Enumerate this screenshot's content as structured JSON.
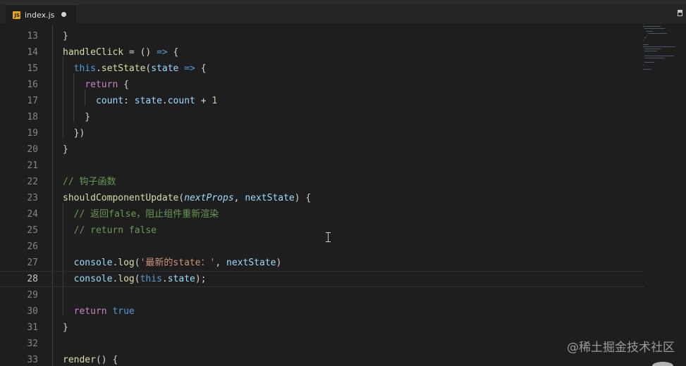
{
  "tab": {
    "filename": "index.js",
    "icon": "javascript-file-icon",
    "icon_letter": "JS",
    "dirty": true
  },
  "editor": {
    "current_line": 28,
    "lines": [
      {
        "n": "13",
        "tokens": [
          {
            "t": "}",
            "c": "p"
          }
        ]
      },
      {
        "n": "14",
        "tokens": [
          {
            "t": "handleClick",
            "c": "fn"
          },
          {
            "t": " = () ",
            "c": "p"
          },
          {
            "t": "=>",
            "c": "kw"
          },
          {
            "t": " {",
            "c": "p"
          }
        ]
      },
      {
        "n": "15",
        "tokens": [
          {
            "t": "  ",
            "c": "p"
          },
          {
            "t": "this",
            "c": "kw"
          },
          {
            "t": ".",
            "c": "p"
          },
          {
            "t": "setState",
            "c": "fn"
          },
          {
            "t": "(",
            "c": "p"
          },
          {
            "t": "state",
            "c": "var"
          },
          {
            "t": " ",
            "c": "p"
          },
          {
            "t": "=>",
            "c": "kw"
          },
          {
            "t": " {",
            "c": "p"
          }
        ]
      },
      {
        "n": "16",
        "tokens": [
          {
            "t": "    ",
            "c": "p"
          },
          {
            "t": "return",
            "c": "kw2"
          },
          {
            "t": " {",
            "c": "p"
          }
        ]
      },
      {
        "n": "17",
        "tokens": [
          {
            "t": "      ",
            "c": "p"
          },
          {
            "t": "count",
            "c": "var"
          },
          {
            "t": ": ",
            "c": "p"
          },
          {
            "t": "state",
            "c": "var"
          },
          {
            "t": ".",
            "c": "p"
          },
          {
            "t": "count",
            "c": "var"
          },
          {
            "t": " + ",
            "c": "p"
          },
          {
            "t": "1",
            "c": "num"
          }
        ]
      },
      {
        "n": "18",
        "tokens": [
          {
            "t": "    }",
            "c": "p"
          }
        ]
      },
      {
        "n": "19",
        "tokens": [
          {
            "t": "  })",
            "c": "p"
          }
        ]
      },
      {
        "n": "20",
        "tokens": [
          {
            "t": "}",
            "c": "p"
          }
        ]
      },
      {
        "n": "21",
        "tokens": []
      },
      {
        "n": "22",
        "tokens": [
          {
            "t": "// 钩子函数",
            "c": "cmt"
          }
        ]
      },
      {
        "n": "23",
        "tokens": [
          {
            "t": "shouldComponentUpdate",
            "c": "fn"
          },
          {
            "t": "(",
            "c": "p"
          },
          {
            "t": "nextProps",
            "c": "var ital"
          },
          {
            "t": ", ",
            "c": "p"
          },
          {
            "t": "nextState",
            "c": "var"
          },
          {
            "t": ") {",
            "c": "p"
          }
        ]
      },
      {
        "n": "24",
        "tokens": [
          {
            "t": "  // 返回false，阻止组件重新渲染",
            "c": "cmt"
          }
        ]
      },
      {
        "n": "25",
        "tokens": [
          {
            "t": "  // return false",
            "c": "cmt"
          }
        ]
      },
      {
        "n": "26",
        "tokens": []
      },
      {
        "n": "27",
        "tokens": [
          {
            "t": "  ",
            "c": "p"
          },
          {
            "t": "console",
            "c": "var"
          },
          {
            "t": ".",
            "c": "p"
          },
          {
            "t": "log",
            "c": "fn"
          },
          {
            "t": "(",
            "c": "p"
          },
          {
            "t": "'最新的state：'",
            "c": "str"
          },
          {
            "t": ", ",
            "c": "p"
          },
          {
            "t": "nextState",
            "c": "var"
          },
          {
            "t": ")",
            "c": "p"
          }
        ]
      },
      {
        "n": "28",
        "tokens": [
          {
            "t": "  ",
            "c": "p"
          },
          {
            "t": "console",
            "c": "var"
          },
          {
            "t": ".",
            "c": "p"
          },
          {
            "t": "log",
            "c": "fn"
          },
          {
            "t": "(",
            "c": "p"
          },
          {
            "t": "this",
            "c": "kw"
          },
          {
            "t": ".",
            "c": "p"
          },
          {
            "t": "state",
            "c": "var"
          },
          {
            "t": ");",
            "c": "p"
          }
        ]
      },
      {
        "n": "29",
        "tokens": []
      },
      {
        "n": "30",
        "tokens": [
          {
            "t": "  ",
            "c": "p"
          },
          {
            "t": "return",
            "c": "kw2"
          },
          {
            "t": " ",
            "c": "p"
          },
          {
            "t": "true",
            "c": "kw"
          }
        ]
      },
      {
        "n": "31",
        "tokens": [
          {
            "t": "}",
            "c": "p"
          }
        ]
      },
      {
        "n": "32",
        "tokens": []
      },
      {
        "n": "33",
        "tokens": [
          {
            "t": "render",
            "c": "fn"
          },
          {
            "t": "() {",
            "c": "p"
          }
        ]
      }
    ]
  },
  "watermark": "@稀土掘金技术社区",
  "colors": {
    "background": "#1e1e1e",
    "tabbar": "#252526",
    "keyword": "#569cd6",
    "control": "#c586c0",
    "function": "#dcdcaa",
    "variable": "#9cdcfe",
    "string": "#ce9178",
    "number": "#b5cea8",
    "comment": "#6a9955"
  }
}
